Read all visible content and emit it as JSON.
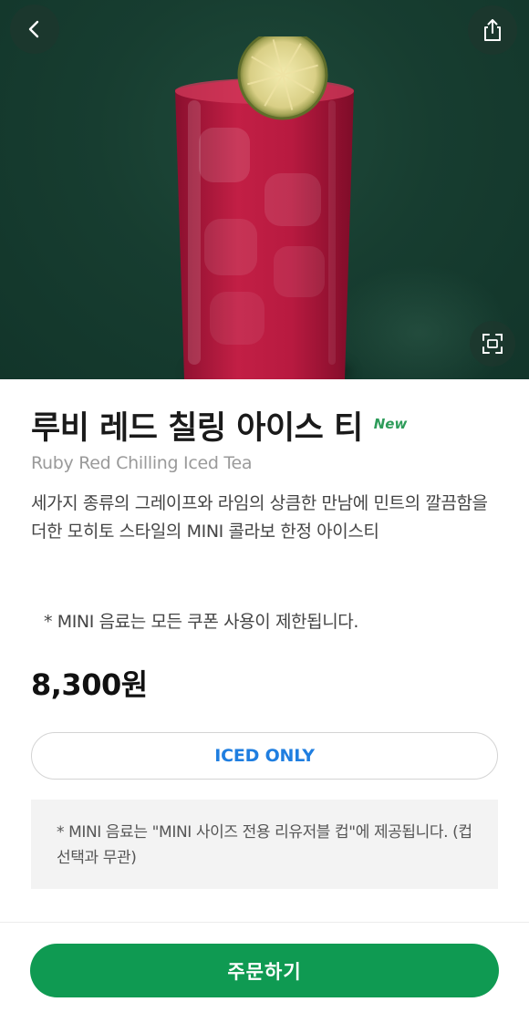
{
  "header": {
    "back_icon": "chevron-left-icon",
    "share_icon": "share-icon",
    "expand_icon": "expand-icon"
  },
  "product": {
    "name_ko": "루비 레드 칠링 아이스 티",
    "badge": "New",
    "name_en": "Ruby Red Chilling Iced Tea",
    "description": "세가지 종류의 그레이프와 라임의 상큼한 만남에 민트의 깔끔함을 더한 모히토 스타일의 MINI 콜라보 한정 아이스티",
    "notice": "* MINI 음료는 모든 쿠폰 사용이 제한됩니다.",
    "price": "8,300원",
    "temperature_option": "ICED ONLY",
    "info": "* MINI 음료는 \"MINI 사이즈 전용 리유저블 컵\"에 제공됩니다. (컵 선택과 무관)"
  },
  "actions": {
    "order_label": "주문하기"
  },
  "colors": {
    "hero_background": "#173d30",
    "accent_green": "#0f9a52",
    "new_badge": "#2e9c5a",
    "option_text": "#1f7ee0"
  }
}
